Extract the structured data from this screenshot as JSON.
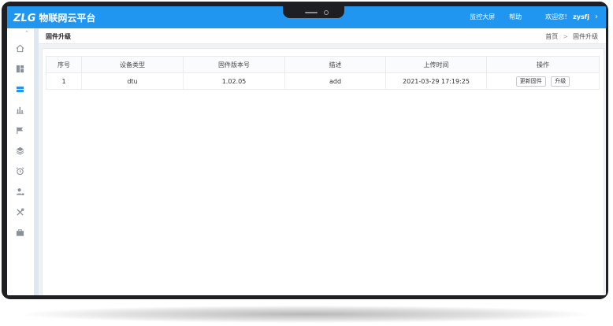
{
  "header": {
    "logo_brand": "ZLG",
    "logo_title": "物联网云平台",
    "nav": [
      "监控大屏",
      "帮助"
    ],
    "welcome": "欢迎您！",
    "username": "zysfj",
    "chevron": "›"
  },
  "sidebar": {
    "collapse_glyph": "⌃",
    "items": [
      {
        "icon": "home-icon"
      },
      {
        "icon": "dashboard-icon"
      },
      {
        "icon": "device-list-icon",
        "active": true
      },
      {
        "icon": "bar-chart-icon"
      },
      {
        "icon": "flag-icon"
      },
      {
        "icon": "layers-icon"
      },
      {
        "icon": "alarm-clock-icon"
      },
      {
        "icon": "user-settings-icon"
      },
      {
        "icon": "tools-icon"
      },
      {
        "icon": "briefcase-icon"
      }
    ]
  },
  "page": {
    "title": "固件升级",
    "breadcrumb": [
      "首页",
      "固件升级"
    ],
    "breadcrumb_sep": ">"
  },
  "table": {
    "columns": [
      "序号",
      "设备类型",
      "固件版本号",
      "描述",
      "上传时间",
      "操作"
    ],
    "rows": [
      {
        "index": "1",
        "device_type": "dtu",
        "firmware_version": "1.02.05",
        "description": "add",
        "upload_time": "2021-03-29 17:19:25",
        "actions": [
          "更新固件",
          "升级"
        ]
      }
    ]
  },
  "colors": {
    "accent": "#2196f0",
    "background": "#f0f2f5",
    "frame": "#1d1f22"
  }
}
